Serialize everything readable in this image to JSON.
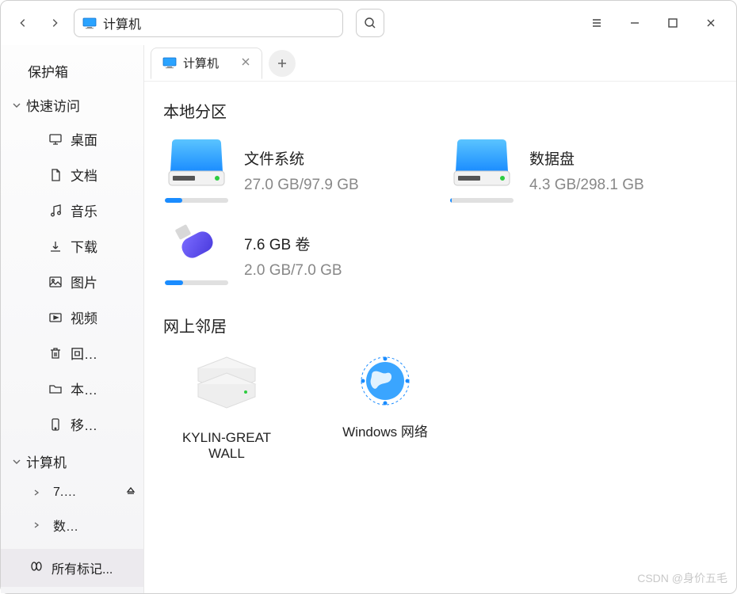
{
  "address": {
    "label": "计算机"
  },
  "sidebar": {
    "protect_box": "保护箱",
    "quick_access": {
      "label": "快速访问",
      "items": [
        "桌面",
        "文档",
        "音乐",
        "下载",
        "图片",
        "视频",
        "回…",
        "本…",
        "移…"
      ]
    },
    "computer": {
      "label": "计算机",
      "items": [
        "7.…",
        "数…"
      ]
    },
    "all_tags": "所有标记..."
  },
  "tab": {
    "label": "计算机"
  },
  "sections": {
    "local": "本地分区",
    "network": "网上邻居"
  },
  "drives": [
    {
      "name": "文件系统",
      "usage": "27.0 GB/97.9 GB",
      "fill": 28,
      "type": "disk"
    },
    {
      "name": "数据盘",
      "usage": "4.3 GB/298.1 GB",
      "fill": 2,
      "type": "disk"
    },
    {
      "name": "7.6 GB 卷",
      "usage": "2.0 GB/7.0 GB",
      "fill": 29,
      "type": "usb"
    }
  ],
  "network": [
    {
      "name": "KYLIN-GREAT\nWALL",
      "type": "server"
    },
    {
      "name": "Windows 网络",
      "type": "globe"
    }
  ],
  "watermark": "CSDN @身价五毛"
}
